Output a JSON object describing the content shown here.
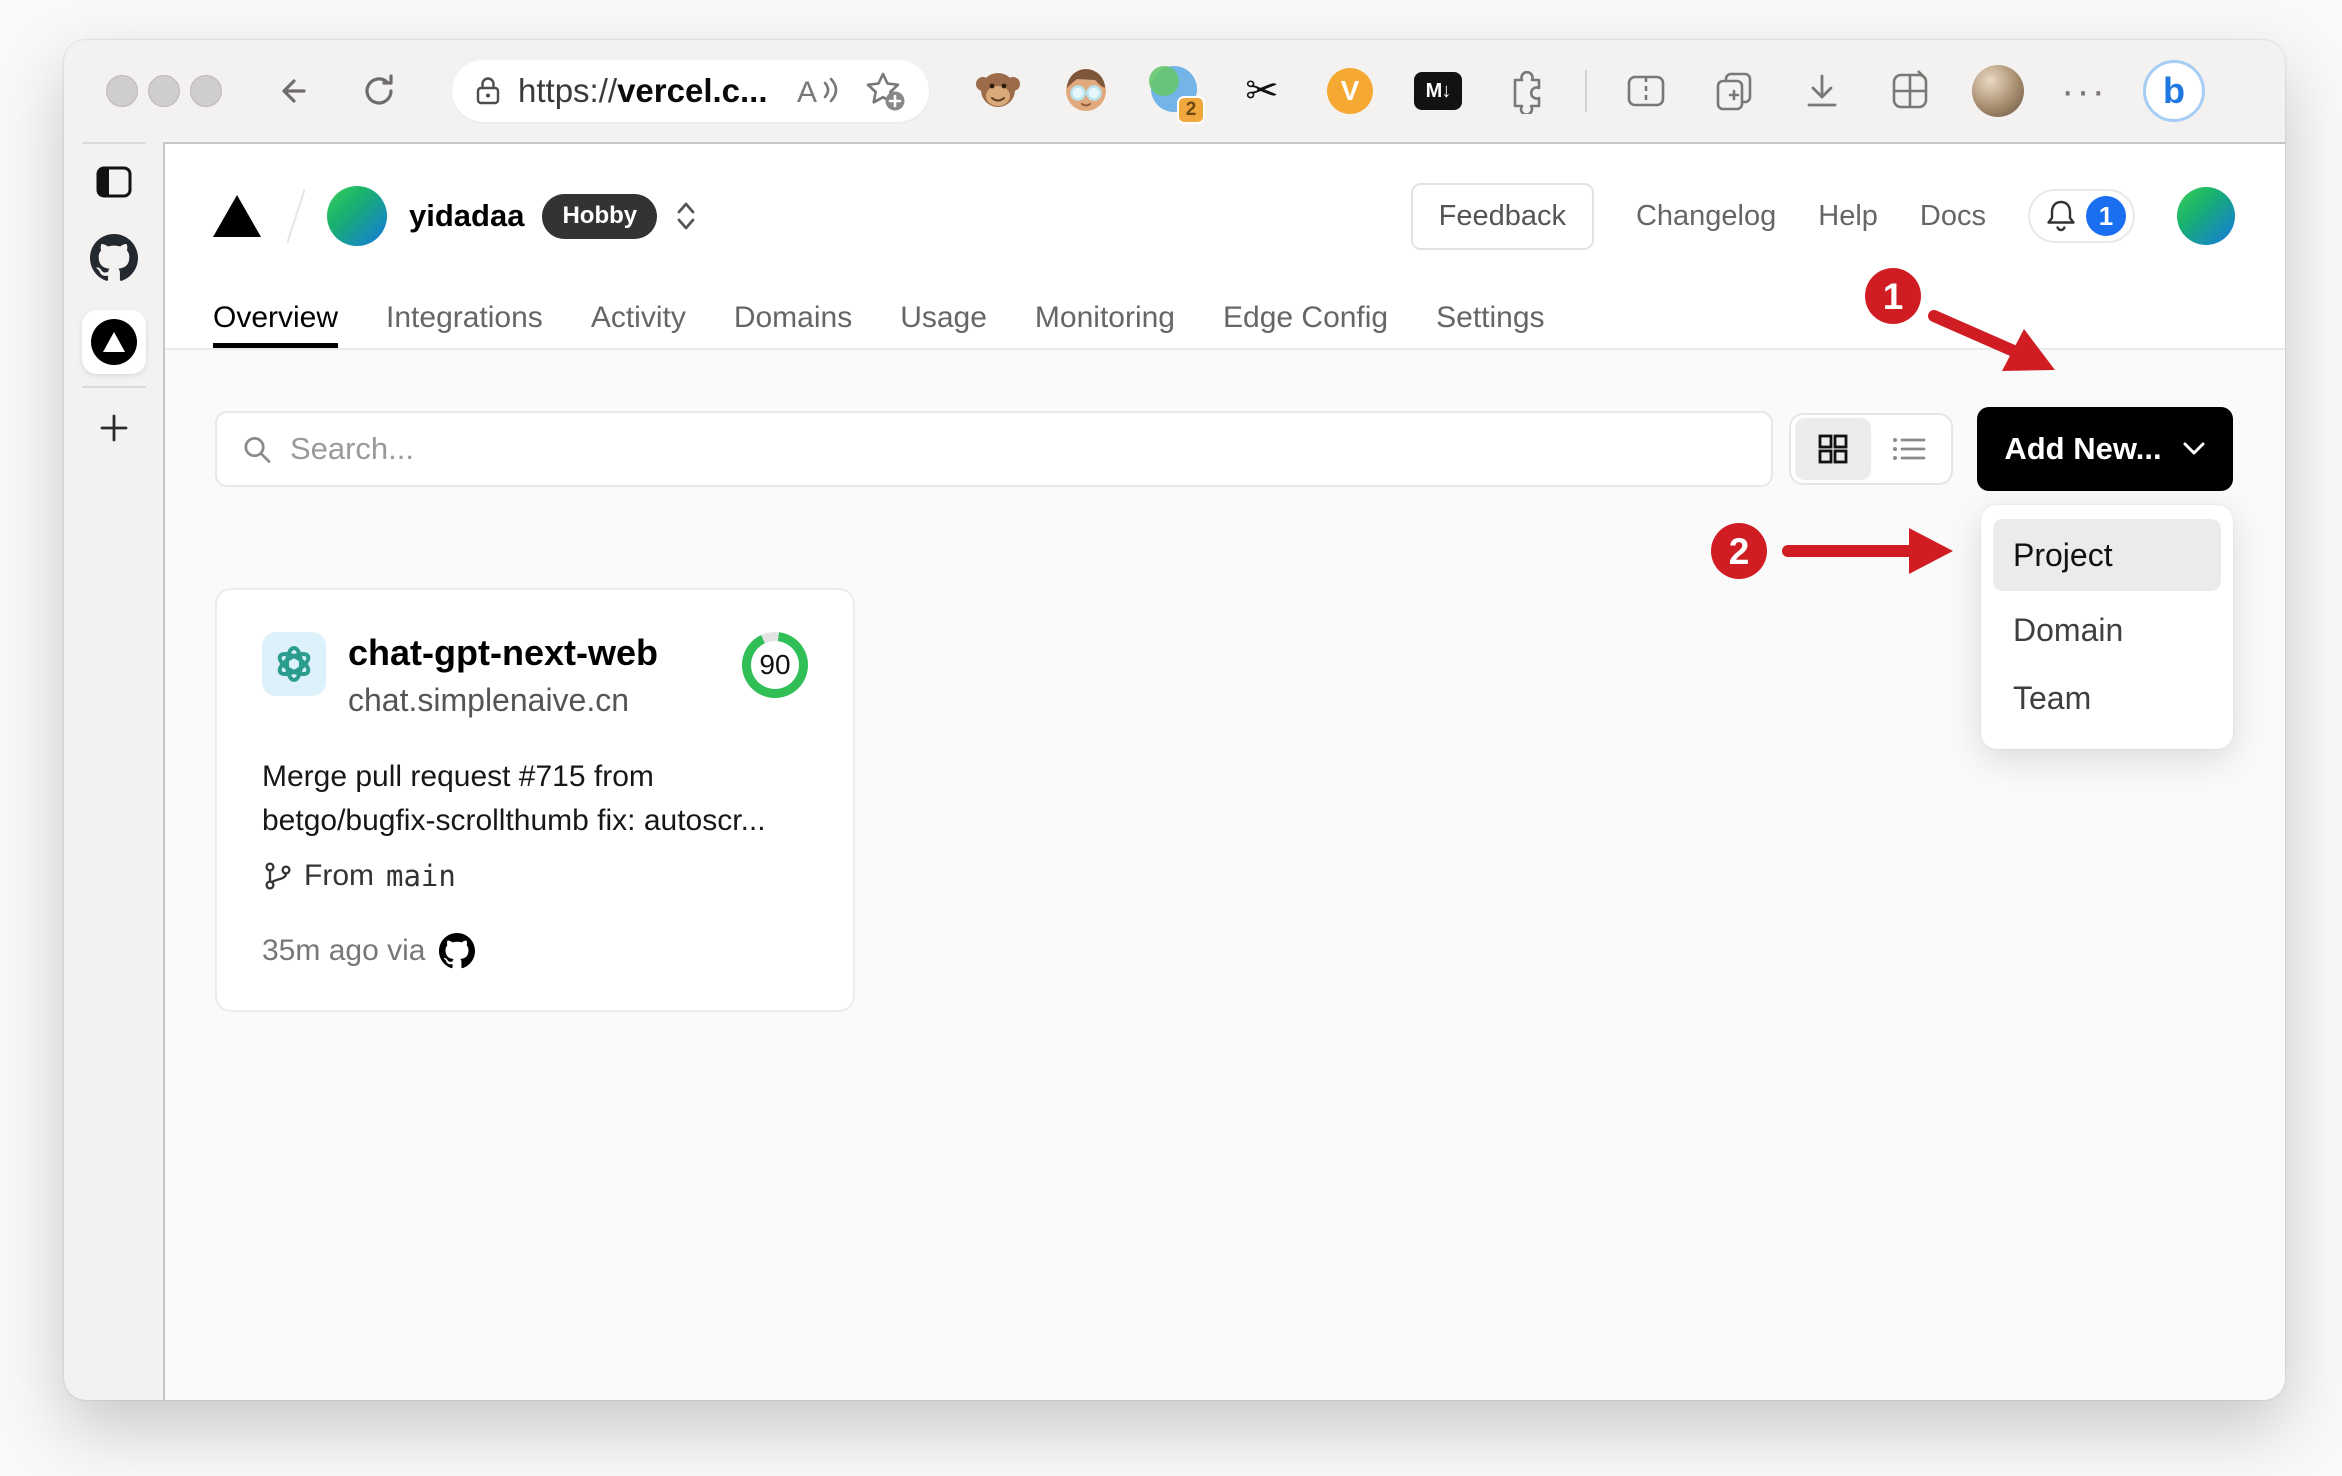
{
  "browser": {
    "url": {
      "scheme": "https://",
      "host": "vercel.c..."
    },
    "reader_label": "A",
    "extension_tab_badge": "2",
    "vimium_letter": "V",
    "markdown_label": "M↓",
    "overflow_ellipsis": "···",
    "bing_letter": "b"
  },
  "vercel": {
    "team": {
      "name": "yidadaa",
      "plan": "Hobby"
    },
    "header_links": {
      "feedback": "Feedback",
      "changelog": "Changelog",
      "help": "Help",
      "docs": "Docs"
    },
    "notification_count": "1",
    "tabs": [
      "Overview",
      "Integrations",
      "Activity",
      "Domains",
      "Usage",
      "Monitoring",
      "Edge Config",
      "Settings"
    ],
    "search_placeholder": "Search...",
    "add_new_label": "Add New...",
    "dropdown": {
      "items": [
        "Project",
        "Domain",
        "Team"
      ],
      "selected": "Project"
    },
    "project": {
      "name": "chat-gpt-next-web",
      "domain": "chat.simplenaive.cn",
      "score": "90",
      "commit_line1": "Merge pull request #715 from",
      "commit_line2": "betgo/bugfix-scrollthumb fix: autoscr...",
      "branch_prefix": "From",
      "branch": "main",
      "deployed": "35m ago via"
    }
  },
  "annotations": {
    "step1": "1",
    "step2": "2"
  },
  "colors": {
    "accent_red": "#cf1d23",
    "score_green": "#2fbf56",
    "notification_blue": "#1a6ef0",
    "button_black": "#000000",
    "hobby_badge_bg": "#333333"
  }
}
